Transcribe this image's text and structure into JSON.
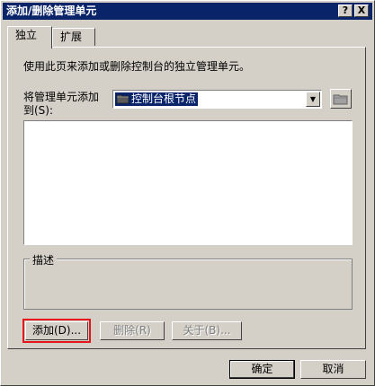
{
  "window": {
    "title": "添加/删除管理单元",
    "help_button": "?",
    "close_button": "X"
  },
  "tabs": [
    {
      "label": "独立",
      "active": true
    },
    {
      "label": "扩展",
      "active": false
    }
  ],
  "panel": {
    "description": "使用此页来添加或删除控制台的独立管理单元。",
    "add_to_label_line1": "将管理单元添加",
    "add_to_label_line2": "到(S):",
    "combo_value": "控制台根节点",
    "group_title": "描述"
  },
  "buttons": {
    "add": "添加(D)...",
    "remove": "删除(R)",
    "about": "关于(B)...",
    "ok": "确定",
    "cancel": "取消"
  },
  "colors": {
    "highlight": "#e8141b",
    "titlebar": "#0a246a"
  }
}
